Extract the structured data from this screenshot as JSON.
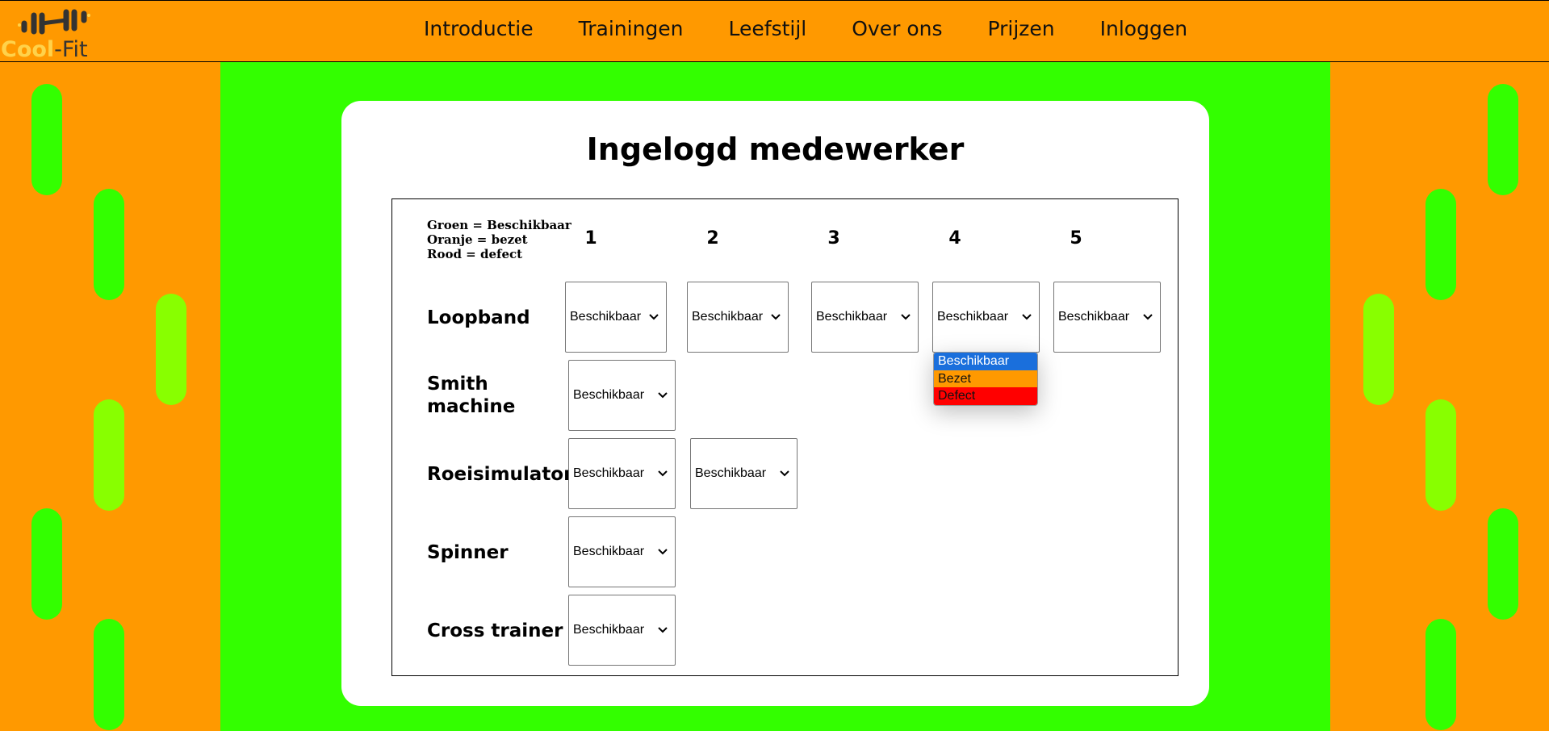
{
  "header": {
    "logo": {
      "word_a": "Cool",
      "word_b": "-Fit"
    },
    "nav": [
      "Introductie",
      "Trainingen",
      "Leefstijl",
      "Over ons",
      "Prijzen",
      "Inloggen"
    ]
  },
  "card": {
    "title": "Ingelogd medewerker",
    "legend": [
      "Groen = Beschikbaar",
      "Oranje = bezet",
      "Rood = defect"
    ],
    "columns": [
      "1",
      "2",
      "3",
      "4",
      "5"
    ],
    "rows": [
      {
        "label_lines": [
          "Loopband"
        ],
        "selects": [
          "Beschikbaar",
          "Beschikbaar",
          "Beschikbaar",
          "Beschikbaar",
          "Beschikbaar"
        ]
      },
      {
        "label_lines": [
          "Smith",
          "machine"
        ],
        "selects": [
          "Beschikbaar"
        ]
      },
      {
        "label_lines": [
          "Roeisimulator"
        ],
        "selects": [
          "Beschikbaar",
          "Beschikbaar"
        ]
      },
      {
        "label_lines": [
          "Spinner"
        ],
        "selects": [
          "Beschikbaar"
        ]
      },
      {
        "label_lines": [
          "Cross trainer"
        ],
        "selects": [
          "Beschikbaar"
        ]
      }
    ],
    "open_dropdown": {
      "options": [
        {
          "label": "Beschikbaar",
          "color": "#1a6fdc",
          "highlighted": true
        },
        {
          "label": "Bezet",
          "color": "#ff9900",
          "highlighted": false
        },
        {
          "label": "Defect",
          "color": "#ff0000",
          "highlighted": false
        }
      ]
    }
  },
  "colors": {
    "orange": "#ff9900",
    "green": "#33ff00",
    "pill_light": "#88ff00"
  },
  "icons": {
    "logo": "dumbbell-icon",
    "select": "chevron-down-icon"
  }
}
